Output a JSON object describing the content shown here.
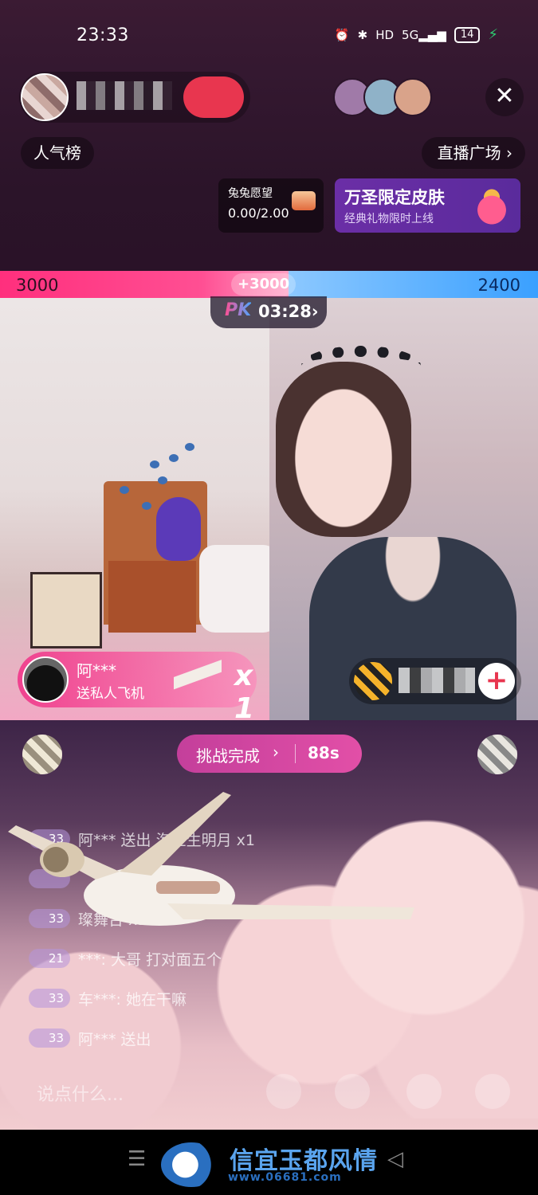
{
  "status_bar": {
    "time": "23:33",
    "icons": [
      "alarm-icon",
      "bluetooth-icon",
      "hd-icon",
      "5g-signal-icon"
    ],
    "hd": "HD",
    "network": "5G",
    "battery": "14"
  },
  "header": {
    "popularity_rank": "人气榜",
    "live_plaza": "直播广场",
    "close": "✕"
  },
  "wish_card": {
    "title": "兔兔愿望",
    "progress": "0.00/2.00"
  },
  "promo_card": {
    "title": "万圣限定皮肤",
    "subtitle": "经典礼物限时上线"
  },
  "pk": {
    "left_score": "3000",
    "delta": "+3000",
    "right_score": "2400",
    "logo": "PK",
    "countdown": "03:28",
    "colors": {
      "left": "#ff2f7d",
      "right": "#3aa0ff"
    }
  },
  "gift_notice": {
    "user": "阿***",
    "action": "送私人飞机",
    "count": "x 1"
  },
  "challenge": {
    "label": "挑战完成",
    "seconds": "88s"
  },
  "chat": [
    {
      "level": "33",
      "text": "阿*** 送出 海上生明月 x1"
    },
    {
      "level": "",
      "text": ""
    },
    {
      "level": "33",
      "text": "璨舞台 x1"
    },
    {
      "level": "21",
      "text": "***: 大哥 打对面五个"
    },
    {
      "level": "33",
      "text": "车***: 她在干嘛"
    },
    {
      "level": "33",
      "text": "阿*** 送出"
    }
  ],
  "input_bar": {
    "placeholder": "说点什么..."
  },
  "watermark": {
    "name": "信宜玉都风情",
    "url": "www.06681.com"
  },
  "nav": {
    "menu": "☰",
    "back": "◁"
  }
}
